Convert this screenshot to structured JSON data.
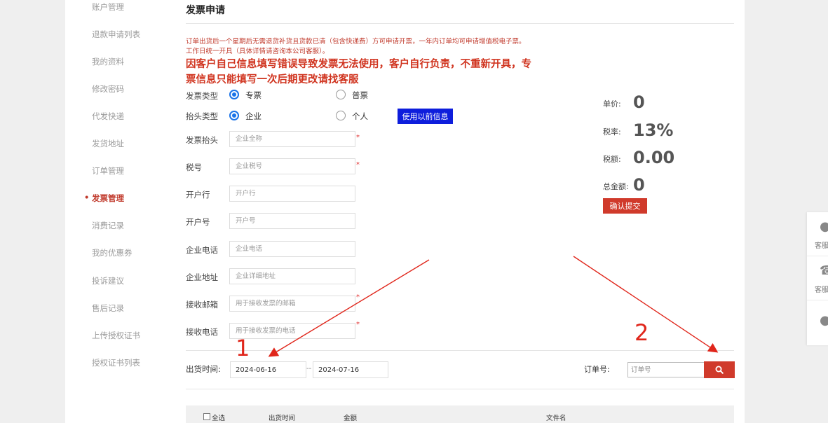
{
  "sidebar": {
    "items": [
      {
        "label": "账户管理",
        "active": false
      },
      {
        "label": "退款申请列表",
        "active": false
      },
      {
        "label": "我的资料",
        "active": false
      },
      {
        "label": "修改密码",
        "active": false
      },
      {
        "label": "代发快递",
        "active": false
      },
      {
        "label": "发货地址",
        "active": false
      },
      {
        "label": "订单管理",
        "active": false
      },
      {
        "label": "发票管理",
        "active": true
      },
      {
        "label": "消费记录",
        "active": false
      },
      {
        "label": "我的优惠券",
        "active": false
      },
      {
        "label": "投诉建议",
        "active": false
      },
      {
        "label": "售后记录",
        "active": false
      },
      {
        "label": "上传授权证书",
        "active": false
      },
      {
        "label": "授权证书列表",
        "active": false
      }
    ],
    "active_bullet": "•"
  },
  "page": {
    "title": "发票申请",
    "notice_line1": "订单出货后一个星期后无需退货补货且货款已清（包含快递费）方可申请开票，一年内订单均可申请增值税电子票。",
    "notice_line2": "工作日统一开具（具体详情请咨询本公司客服）。",
    "warning_line1": "因客户自己信息填写错误导致发票无法使用，客户自行负责，不重新开具，专",
    "warning_line2": "票信息只能填写一次后期更改请找客服"
  },
  "form": {
    "invoice_type": {
      "label": "发票类型",
      "options": [
        "专票",
        "普票"
      ],
      "selected": "专票"
    },
    "header_type": {
      "label": "抬头类型",
      "options": [
        "企业",
        "个人"
      ],
      "selected": "企业"
    },
    "use_previous_label": "使用以前信息",
    "fields": [
      {
        "label": "发票抬头",
        "placeholder": "企业全称",
        "required": true
      },
      {
        "label": "税号",
        "placeholder": "企业税号",
        "required": true
      },
      {
        "label": "开户行",
        "placeholder": "开户行",
        "required": false
      },
      {
        "label": "开户号",
        "placeholder": "开户号",
        "required": false
      },
      {
        "label": "企业电话",
        "placeholder": "企业电话",
        "required": false
      },
      {
        "label": "企业地址",
        "placeholder": "企业详细地址",
        "required": false
      },
      {
        "label": "接收邮箱",
        "placeholder": "用于接收发票的邮箱",
        "required": true
      },
      {
        "label": "接收电话",
        "placeholder": "用于接收发票的电话",
        "required": true
      }
    ],
    "required_mark": "*"
  },
  "summary": {
    "unit_price_label": "单价:",
    "unit_price": "0",
    "tax_rate_label": "税率:",
    "tax_rate": "13%",
    "tax_amount_label": "税额:",
    "tax_amount": "0.00",
    "total_label": "总金额:",
    "total": "0",
    "submit_label": "确认提交"
  },
  "filter": {
    "date_label": "出货时间:",
    "date_from": "2024-06-16",
    "date_sep": "--",
    "date_to": "2024-07-16",
    "order_label": "订单号:",
    "order_placeholder": "订单号",
    "search_icon": "search-icon"
  },
  "table": {
    "select_all_label": "全选",
    "headers": [
      "出货时间",
      "金额",
      "文件名"
    ]
  },
  "float_panel": {
    "items": [
      {
        "icon": "chat-icon",
        "label": "客服"
      },
      {
        "icon": "phone-icon",
        "label": "客服"
      },
      {
        "icon": "bell-icon",
        "label": ""
      }
    ]
  },
  "annotations": {
    "arrow1_label": "1",
    "arrow2_label": "2",
    "color": "#e0261b"
  },
  "colors": {
    "accent_red": "#d03a2b",
    "radio_blue": "#1a73e8",
    "button_blue": "#0e1edc"
  }
}
